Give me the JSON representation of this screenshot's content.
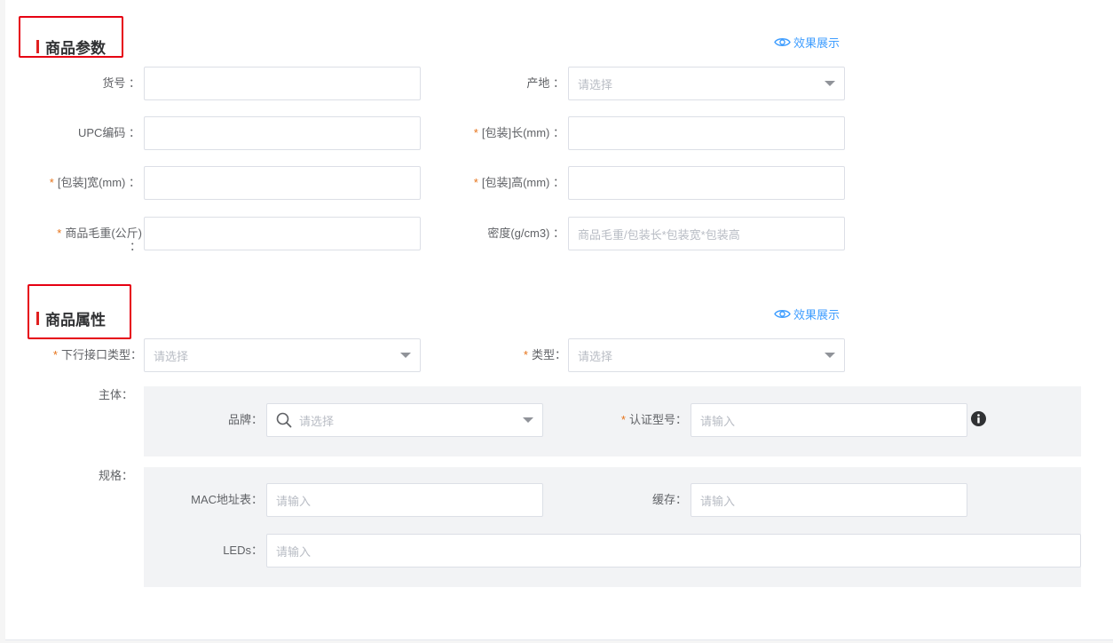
{
  "params": {
    "title": "商品参数",
    "preview": "效果展示",
    "fields": {
      "item_no": {
        "label": "货号 ：",
        "value": "",
        "required": false
      },
      "origin": {
        "label": "产地 ：",
        "placeholder": "请选择",
        "required": false
      },
      "upc": {
        "label": "UPC编码 ：",
        "value": "",
        "required": false
      },
      "pkg_length": {
        "label": "[包装]长(mm) ：",
        "value": "",
        "required": true
      },
      "pkg_width": {
        "label": "[包装]宽(mm) ：",
        "value": "",
        "required": true
      },
      "pkg_height": {
        "label": "[包装]高(mm) ：",
        "value": "",
        "required": true
      },
      "gross_weight": {
        "label": "商品毛重(公斤)",
        "label_colon": "：",
        "value": "",
        "required": true
      },
      "density": {
        "label": "密度(g/cm3) ：",
        "placeholder": "商品毛重/包装长*包装宽*包装高",
        "required": false
      }
    }
  },
  "attrs": {
    "title": "商品属性",
    "preview": "效果展示",
    "fields": {
      "downlink_type": {
        "label": "下行接口类型：",
        "placeholder": "请选择",
        "required": true
      },
      "type": {
        "label": "类型：",
        "placeholder": "请选择",
        "required": true
      }
    },
    "subject": {
      "label": "主体：",
      "brand": {
        "label": "品牌：",
        "placeholder": "请选择"
      },
      "cert_model": {
        "label": "认证型号：",
        "placeholder": "请输入",
        "required": true
      }
    },
    "spec": {
      "label": "规格：",
      "mac_table": {
        "label": "MAC地址表：",
        "placeholder": "请输入"
      },
      "cache": {
        "label": "缓存：",
        "placeholder": "请输入"
      },
      "leds": {
        "label": "LEDs：",
        "placeholder": "请输入"
      }
    }
  },
  "colors": {
    "accent": "#409eff",
    "required_star": "#e6731a",
    "highlight_box": "#e60012",
    "section_bar": "#e02020"
  }
}
